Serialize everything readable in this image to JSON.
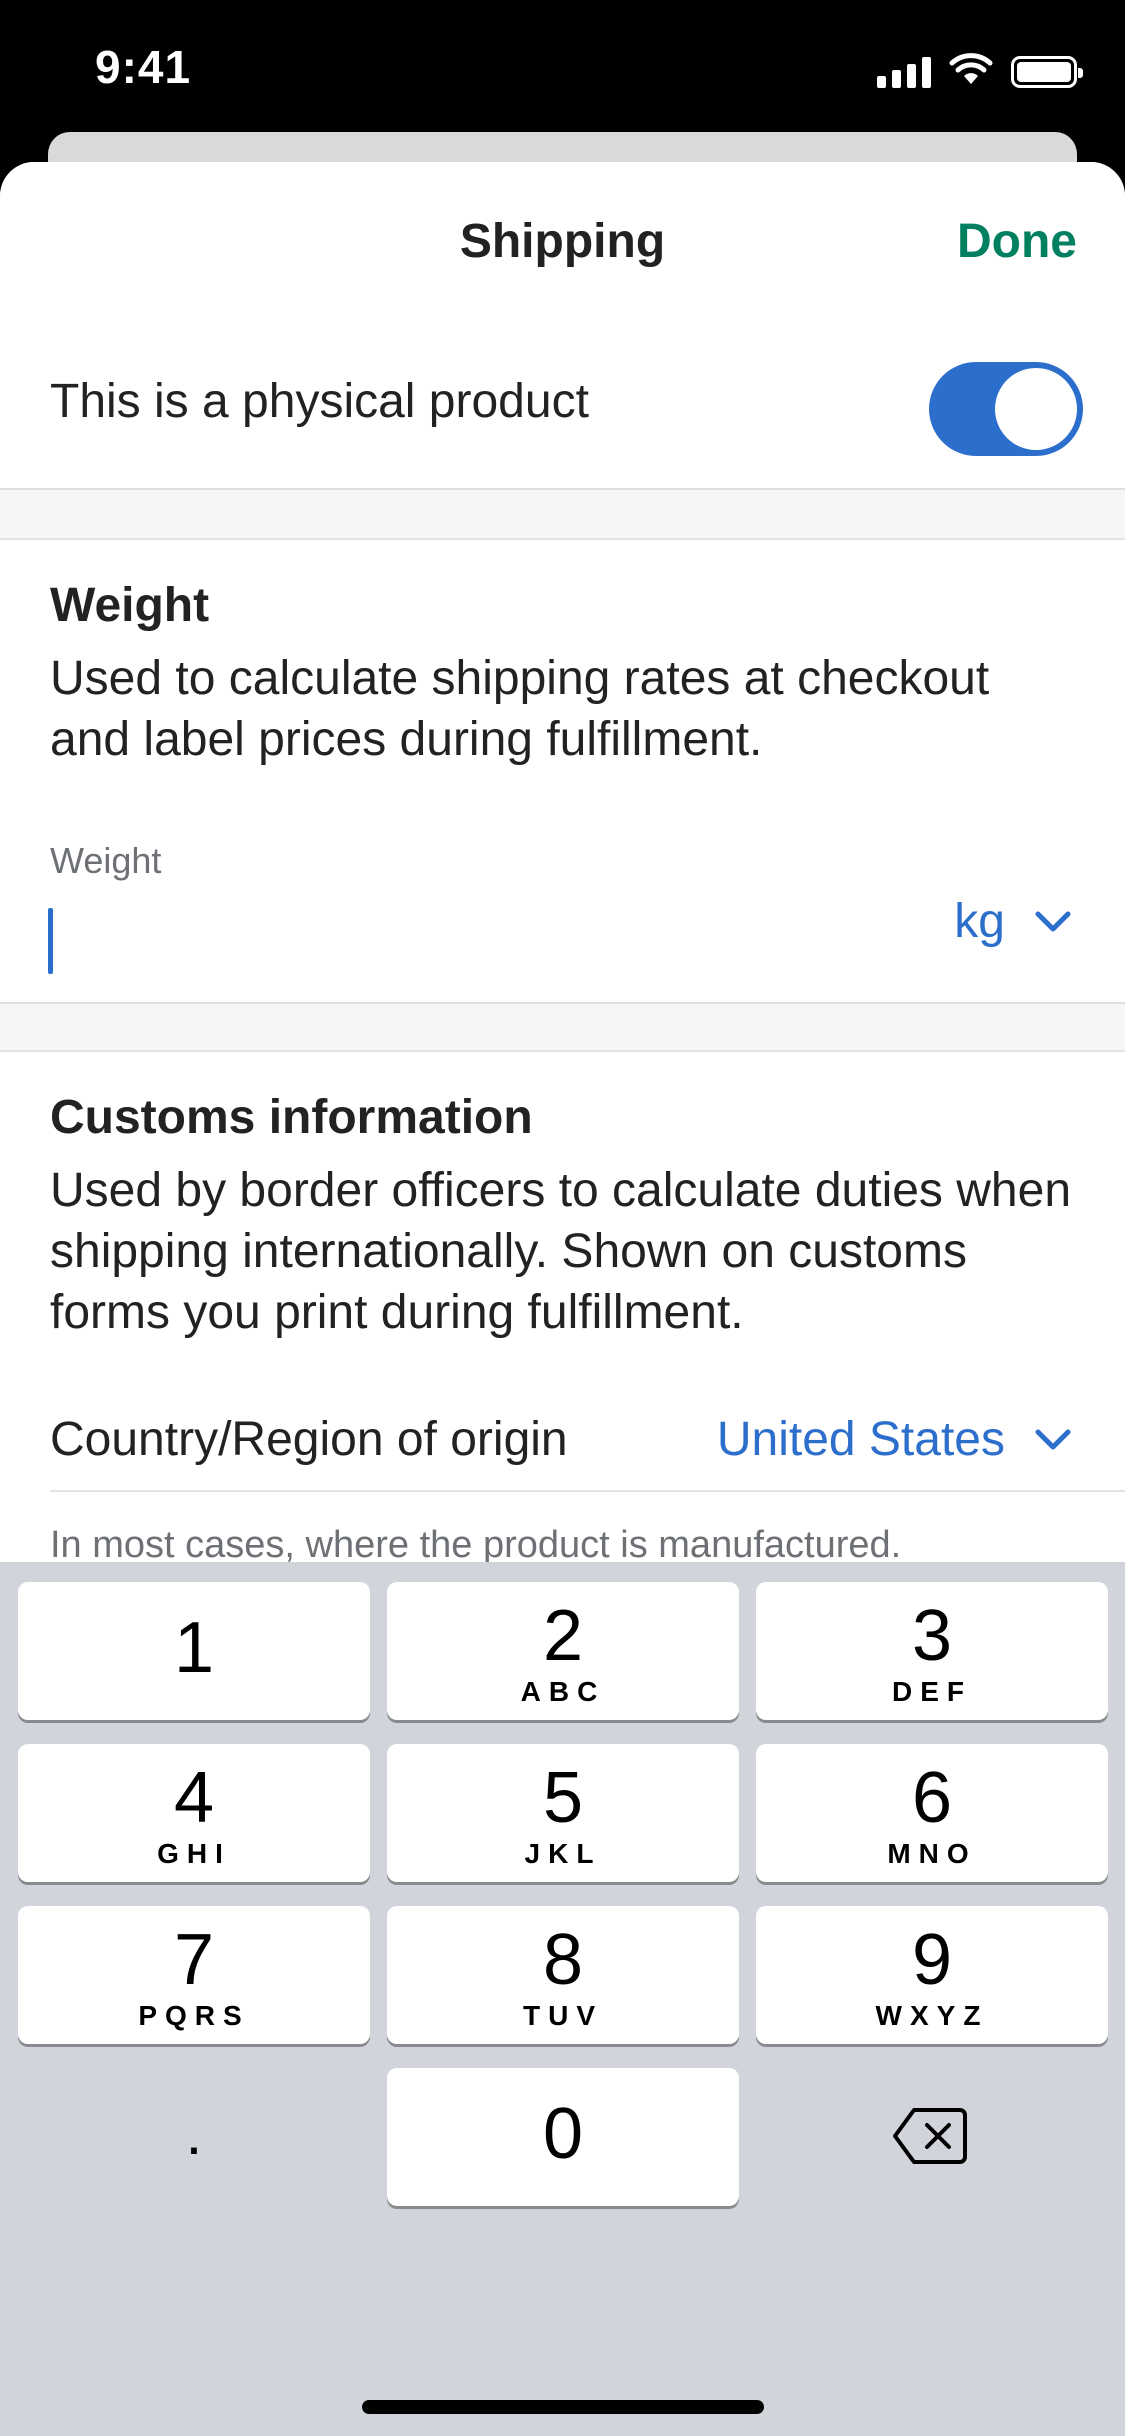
{
  "status_bar": {
    "time": "9:41",
    "icons": [
      "signal-icon",
      "wifi-icon",
      "battery-icon"
    ]
  },
  "header": {
    "title": "Shipping",
    "done_label": "Done"
  },
  "physical_toggle": {
    "label": "This is a physical product",
    "on": true
  },
  "weight": {
    "title": "Weight",
    "description": "Used to calculate shipping rates at checkout and label prices during fulfillment.",
    "field_label": "Weight",
    "value": "",
    "unit": "kg"
  },
  "customs": {
    "title": "Customs information",
    "description": "Used by border officers to calculate duties when shipping internationally. Shown on customs forms you print during fulfillment.",
    "country_label": "Country/Region of origin",
    "country_value": "United States",
    "helper": "In most cases, where the product is manufactured."
  },
  "keyboard": {
    "keys": [
      {
        "num": "1",
        "letters": ""
      },
      {
        "num": "2",
        "letters": "ABC"
      },
      {
        "num": "3",
        "letters": "DEF"
      },
      {
        "num": "4",
        "letters": "GHI"
      },
      {
        "num": "5",
        "letters": "JKL"
      },
      {
        "num": "6",
        "letters": "MNO"
      },
      {
        "num": "7",
        "letters": "PQRS"
      },
      {
        "num": "8",
        "letters": "TUV"
      },
      {
        "num": "9",
        "letters": "WXYZ"
      },
      {
        "num": "0",
        "letters": ""
      }
    ],
    "decimal": ".",
    "delete_icon": "delete-backspace-icon"
  },
  "colors": {
    "accent_blue": "#2c6ecb",
    "done_green": "#008060",
    "text": "#202223",
    "subdued": "#6d7175"
  }
}
